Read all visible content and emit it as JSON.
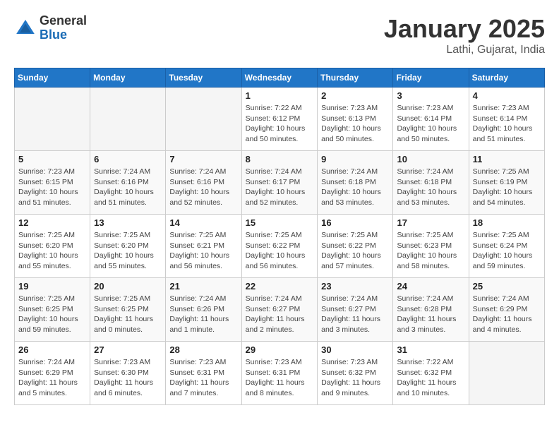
{
  "logo": {
    "general": "General",
    "blue": "Blue"
  },
  "title": "January 2025",
  "subtitle": "Lathi, Gujarat, India",
  "weekdays": [
    "Sunday",
    "Monday",
    "Tuesday",
    "Wednesday",
    "Thursday",
    "Friday",
    "Saturday"
  ],
  "weeks": [
    [
      {
        "day": "",
        "info": ""
      },
      {
        "day": "",
        "info": ""
      },
      {
        "day": "",
        "info": ""
      },
      {
        "day": "1",
        "info": "Sunrise: 7:22 AM\nSunset: 6:12 PM\nDaylight: 10 hours\nand 50 minutes."
      },
      {
        "day": "2",
        "info": "Sunrise: 7:23 AM\nSunset: 6:13 PM\nDaylight: 10 hours\nand 50 minutes."
      },
      {
        "day": "3",
        "info": "Sunrise: 7:23 AM\nSunset: 6:14 PM\nDaylight: 10 hours\nand 50 minutes."
      },
      {
        "day": "4",
        "info": "Sunrise: 7:23 AM\nSunset: 6:14 PM\nDaylight: 10 hours\nand 51 minutes."
      }
    ],
    [
      {
        "day": "5",
        "info": "Sunrise: 7:23 AM\nSunset: 6:15 PM\nDaylight: 10 hours\nand 51 minutes."
      },
      {
        "day": "6",
        "info": "Sunrise: 7:24 AM\nSunset: 6:16 PM\nDaylight: 10 hours\nand 51 minutes."
      },
      {
        "day": "7",
        "info": "Sunrise: 7:24 AM\nSunset: 6:16 PM\nDaylight: 10 hours\nand 52 minutes."
      },
      {
        "day": "8",
        "info": "Sunrise: 7:24 AM\nSunset: 6:17 PM\nDaylight: 10 hours\nand 52 minutes."
      },
      {
        "day": "9",
        "info": "Sunrise: 7:24 AM\nSunset: 6:18 PM\nDaylight: 10 hours\nand 53 minutes."
      },
      {
        "day": "10",
        "info": "Sunrise: 7:24 AM\nSunset: 6:18 PM\nDaylight: 10 hours\nand 53 minutes."
      },
      {
        "day": "11",
        "info": "Sunrise: 7:25 AM\nSunset: 6:19 PM\nDaylight: 10 hours\nand 54 minutes."
      }
    ],
    [
      {
        "day": "12",
        "info": "Sunrise: 7:25 AM\nSunset: 6:20 PM\nDaylight: 10 hours\nand 55 minutes."
      },
      {
        "day": "13",
        "info": "Sunrise: 7:25 AM\nSunset: 6:20 PM\nDaylight: 10 hours\nand 55 minutes."
      },
      {
        "day": "14",
        "info": "Sunrise: 7:25 AM\nSunset: 6:21 PM\nDaylight: 10 hours\nand 56 minutes."
      },
      {
        "day": "15",
        "info": "Sunrise: 7:25 AM\nSunset: 6:22 PM\nDaylight: 10 hours\nand 56 minutes."
      },
      {
        "day": "16",
        "info": "Sunrise: 7:25 AM\nSunset: 6:22 PM\nDaylight: 10 hours\nand 57 minutes."
      },
      {
        "day": "17",
        "info": "Sunrise: 7:25 AM\nSunset: 6:23 PM\nDaylight: 10 hours\nand 58 minutes."
      },
      {
        "day": "18",
        "info": "Sunrise: 7:25 AM\nSunset: 6:24 PM\nDaylight: 10 hours\nand 59 minutes."
      }
    ],
    [
      {
        "day": "19",
        "info": "Sunrise: 7:25 AM\nSunset: 6:25 PM\nDaylight: 10 hours\nand 59 minutes."
      },
      {
        "day": "20",
        "info": "Sunrise: 7:25 AM\nSunset: 6:25 PM\nDaylight: 11 hours\nand 0 minutes."
      },
      {
        "day": "21",
        "info": "Sunrise: 7:24 AM\nSunset: 6:26 PM\nDaylight: 11 hours\nand 1 minute."
      },
      {
        "day": "22",
        "info": "Sunrise: 7:24 AM\nSunset: 6:27 PM\nDaylight: 11 hours\nand 2 minutes."
      },
      {
        "day": "23",
        "info": "Sunrise: 7:24 AM\nSunset: 6:27 PM\nDaylight: 11 hours\nand 3 minutes."
      },
      {
        "day": "24",
        "info": "Sunrise: 7:24 AM\nSunset: 6:28 PM\nDaylight: 11 hours\nand 3 minutes."
      },
      {
        "day": "25",
        "info": "Sunrise: 7:24 AM\nSunset: 6:29 PM\nDaylight: 11 hours\nand 4 minutes."
      }
    ],
    [
      {
        "day": "26",
        "info": "Sunrise: 7:24 AM\nSunset: 6:29 PM\nDaylight: 11 hours\nand 5 minutes."
      },
      {
        "day": "27",
        "info": "Sunrise: 7:23 AM\nSunset: 6:30 PM\nDaylight: 11 hours\nand 6 minutes."
      },
      {
        "day": "28",
        "info": "Sunrise: 7:23 AM\nSunset: 6:31 PM\nDaylight: 11 hours\nand 7 minutes."
      },
      {
        "day": "29",
        "info": "Sunrise: 7:23 AM\nSunset: 6:31 PM\nDaylight: 11 hours\nand 8 minutes."
      },
      {
        "day": "30",
        "info": "Sunrise: 7:23 AM\nSunset: 6:32 PM\nDaylight: 11 hours\nand 9 minutes."
      },
      {
        "day": "31",
        "info": "Sunrise: 7:22 AM\nSunset: 6:32 PM\nDaylight: 11 hours\nand 10 minutes."
      },
      {
        "day": "",
        "info": ""
      }
    ]
  ]
}
